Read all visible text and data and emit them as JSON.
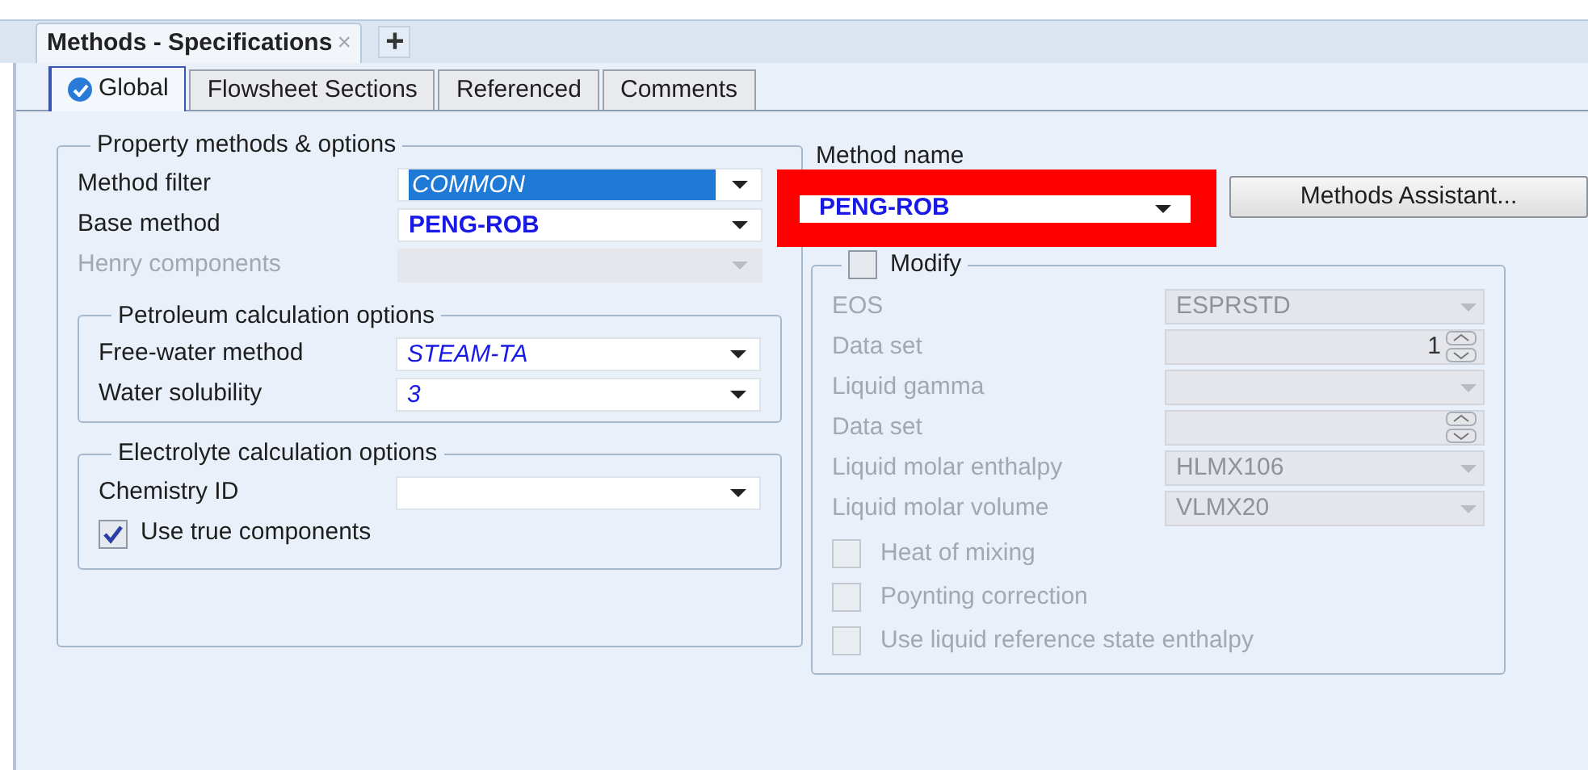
{
  "document_tabs": [
    {
      "label": "Methods - Specifications",
      "selected": true,
      "close": "×"
    }
  ],
  "new_tab_button": "+",
  "tabs": [
    {
      "label": "Global",
      "selected": true,
      "complete": true
    },
    {
      "label": "Flowsheet Sections",
      "selected": false,
      "complete": false
    },
    {
      "label": "Referenced",
      "selected": false,
      "complete": false
    },
    {
      "label": "Comments",
      "selected": false,
      "complete": false
    }
  ],
  "property_methods": {
    "title": "Property methods & options",
    "fields": [
      {
        "label": "Method filter",
        "value": "COMMON",
        "disabled": false,
        "highlighted": true,
        "is_default": true
      },
      {
        "label": "Base method",
        "value": "PENG-ROB",
        "disabled": false,
        "highlighted": false,
        "is_default": false
      },
      {
        "label": "Henry components",
        "disabled": true
      }
    ]
  },
  "petroleum": {
    "title": "Petroleum calculation options",
    "fields": [
      {
        "label": "Free-water method",
        "value": "STEAM-TA",
        "disabled": false,
        "highlighted": false,
        "is_default": true
      },
      {
        "label": "Water solubility",
        "value": "3",
        "disabled": false,
        "highlighted": false,
        "is_default": true
      }
    ]
  },
  "electrolyte": {
    "title": "Electrolyte calculation options",
    "fields": [
      {
        "label": "Chemistry ID",
        "disabled": false
      }
    ],
    "use_true_components": {
      "label": "Use true components",
      "checked": true
    }
  },
  "method_name": {
    "label": "Method name",
    "value": "PENG-ROB",
    "emphasized": true
  },
  "methods_assistant_button": "Methods Assistant...",
  "modify": {
    "label": "Modify",
    "checked": false,
    "rows": [
      {
        "kind": "select",
        "label": "EOS",
        "value": "ESPRSTD"
      },
      {
        "kind": "spin",
        "label": "Data set",
        "value": "1"
      },
      {
        "kind": "select",
        "label": "Liquid gamma"
      },
      {
        "kind": "spin",
        "label": "Data set"
      },
      {
        "kind": "select",
        "label": "Liquid molar enthalpy",
        "value": "HLMX106"
      },
      {
        "kind": "select",
        "label": "Liquid molar volume",
        "value": "VLMX20"
      },
      {
        "kind": "check",
        "label": "Heat of mixing",
        "checked": false
      },
      {
        "kind": "check",
        "label": "Poynting correction",
        "checked": false
      },
      {
        "kind": "check",
        "label": "Use liquid reference state enthalpy",
        "checked": false
      }
    ]
  }
}
